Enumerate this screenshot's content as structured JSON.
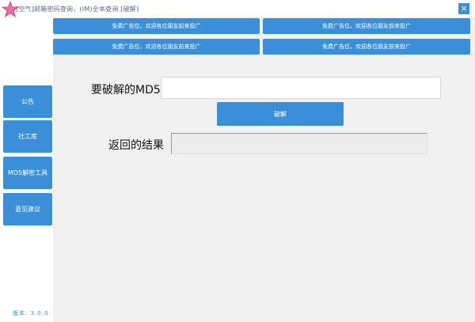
{
  "titlebar": {
    "title": "[空气]邮箱密码查询，(IM)全本查询 [破解]",
    "close_label": "×"
  },
  "sidebar": {
    "items": [
      {
        "label": "公告"
      },
      {
        "label": "社工库"
      },
      {
        "label": "MD5解密工具"
      },
      {
        "label": "意见建议"
      }
    ],
    "version": "版本: 3.0.0"
  },
  "ads": [
    {
      "label": "免费广告位，欢迎各位朋友前来投广"
    },
    {
      "label": "免费广告位，欢迎各位朋友前来投广"
    },
    {
      "label": "免费广告位，欢迎各位朋友前来投广"
    },
    {
      "label": "免费广告位，欢迎各位朋友前来投广"
    }
  ],
  "form": {
    "md5_label": "要破解的MD5",
    "md5_value": "",
    "crack_button": "破解",
    "result_label": "返回的结果",
    "result_value": ""
  },
  "colors": {
    "accent": "#3b8fd8",
    "logo_pink": "#f06aa6"
  }
}
